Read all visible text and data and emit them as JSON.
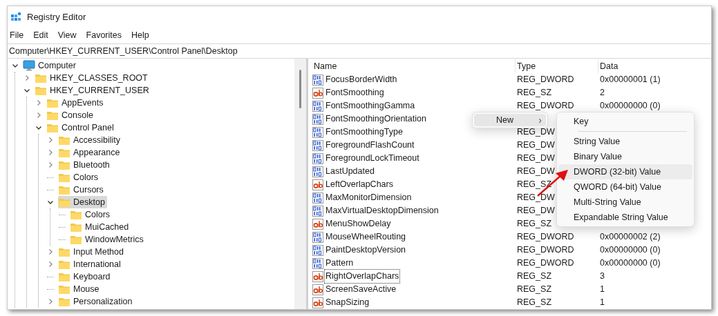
{
  "window": {
    "title": "Registry Editor"
  },
  "menu_bar": [
    "File",
    "Edit",
    "View",
    "Favorites",
    "Help"
  ],
  "address": "Computer\\HKEY_CURRENT_USER\\Control Panel\\Desktop",
  "tree": [
    {
      "label": "Computer",
      "kind": "computer",
      "expanded": true,
      "selected": false,
      "children": [
        {
          "label": "HKEY_CLASSES_ROOT",
          "kind": "folder",
          "expanded": false,
          "selected": false
        },
        {
          "label": "HKEY_CURRENT_USER",
          "kind": "folder",
          "expanded": true,
          "selected": false,
          "children": [
            {
              "label": "AppEvents",
              "kind": "folder",
              "expanded": false,
              "selected": false
            },
            {
              "label": "Console",
              "kind": "folder",
              "expanded": false,
              "selected": false
            },
            {
              "label": "Control Panel",
              "kind": "folder",
              "expanded": true,
              "selected": false,
              "children": [
                {
                  "label": "Accessibility",
                  "kind": "folder",
                  "expanded": false,
                  "selected": false
                },
                {
                  "label": "Appearance",
                  "kind": "folder",
                  "expanded": false,
                  "selected": false
                },
                {
                  "label": "Bluetooth",
                  "kind": "folder",
                  "expanded": false,
                  "selected": false
                },
                {
                  "label": "Colors",
                  "kind": "folder",
                  "selected": false
                },
                {
                  "label": "Cursors",
                  "kind": "folder",
                  "selected": false
                },
                {
                  "label": "Desktop",
                  "kind": "folder",
                  "expanded": true,
                  "selected": true,
                  "children": [
                    {
                      "label": "Colors",
                      "kind": "folder",
                      "selected": false
                    },
                    {
                      "label": "MuiCached",
                      "kind": "folder",
                      "selected": false
                    },
                    {
                      "label": "WindowMetrics",
                      "kind": "folder",
                      "selected": false
                    }
                  ]
                },
                {
                  "label": "Input Method",
                  "kind": "folder",
                  "expanded": false,
                  "selected": false
                },
                {
                  "label": "International",
                  "kind": "folder",
                  "expanded": false,
                  "selected": false
                },
                {
                  "label": "Keyboard",
                  "kind": "folder",
                  "selected": false
                },
                {
                  "label": "Mouse",
                  "kind": "folder",
                  "selected": false
                },
                {
                  "label": "Personalization",
                  "kind": "folder",
                  "expanded": false,
                  "selected": false
                }
              ]
            }
          ]
        }
      ]
    }
  ],
  "table": {
    "columns": [
      "Name",
      "Type",
      "Data"
    ],
    "rows": [
      {
        "name": "FocusBorderWidth",
        "kind": "dword",
        "type": "REG_DWORD",
        "data": "0x00000001 (1)",
        "focused": false
      },
      {
        "name": "FontSmoothing",
        "kind": "string",
        "type": "REG_SZ",
        "data": "2",
        "focused": false
      },
      {
        "name": "FontSmoothingGamma",
        "kind": "dword",
        "type": "REG_DWORD",
        "data": "0x00000000 (0)",
        "focused": false
      },
      {
        "name": "FontSmoothingOrientation",
        "kind": "dword",
        "focused": false
      },
      {
        "name": "FontSmoothingType",
        "kind": "dword",
        "type": "REG_DW",
        "focused": false
      },
      {
        "name": "ForegroundFlashCount",
        "kind": "dword",
        "type": "REG_DW",
        "focused": false
      },
      {
        "name": "ForegroundLockTimeout",
        "kind": "dword",
        "type": "REG_DW",
        "focused": false
      },
      {
        "name": "LastUpdated",
        "kind": "dword",
        "type": "REG_DW",
        "focused": false
      },
      {
        "name": "LeftOverlapChars",
        "kind": "string",
        "type": "REG_SZ",
        "focused": false
      },
      {
        "name": "MaxMonitorDimension",
        "kind": "dword",
        "type": "REG_DW",
        "focused": false
      },
      {
        "name": "MaxVirtualDesktopDimension",
        "kind": "dword",
        "type": "REG_DW",
        "focused": false
      },
      {
        "name": "MenuShowDelay",
        "kind": "string",
        "type": "REG_SZ",
        "focused": false
      },
      {
        "name": "MouseWheelRouting",
        "kind": "dword",
        "type": "REG_DWORD",
        "data": "0x00000002 (2)",
        "focused": false
      },
      {
        "name": "PaintDesktopVersion",
        "kind": "dword",
        "type": "REG_DWORD",
        "data": "0x00000000 (0)",
        "focused": false
      },
      {
        "name": "Pattern",
        "kind": "dword",
        "type": "REG_DWORD",
        "data": "0x00000000 (0)",
        "focused": false
      },
      {
        "name": "RightOverlapChars",
        "kind": "string",
        "type": "REG_SZ",
        "data": "3",
        "focused": true
      },
      {
        "name": "ScreenSaveActive",
        "kind": "string",
        "type": "REG_SZ",
        "data": "1",
        "focused": false
      },
      {
        "name": "SnapSizing",
        "kind": "string",
        "type": "REG_SZ",
        "data": "1",
        "focused": false
      }
    ]
  },
  "context_menu": {
    "items": [
      {
        "label": "New",
        "arrow": "›",
        "selected": true
      }
    ]
  },
  "submenu": {
    "items": [
      {
        "kind": "item",
        "label": "Key",
        "selected": false
      },
      {
        "kind": "separator"
      },
      {
        "kind": "item",
        "label": "String Value",
        "selected": false
      },
      {
        "kind": "item",
        "label": "Binary Value",
        "selected": false
      },
      {
        "kind": "item",
        "label": "DWORD (32-bit) Value",
        "selected": true
      },
      {
        "kind": "item",
        "label": "QWORD (64-bit) Value",
        "selected": false
      },
      {
        "kind": "item",
        "label": "Multi-String Value",
        "selected": false
      },
      {
        "kind": "item",
        "label": "Expandable String Value",
        "selected": false
      }
    ]
  }
}
